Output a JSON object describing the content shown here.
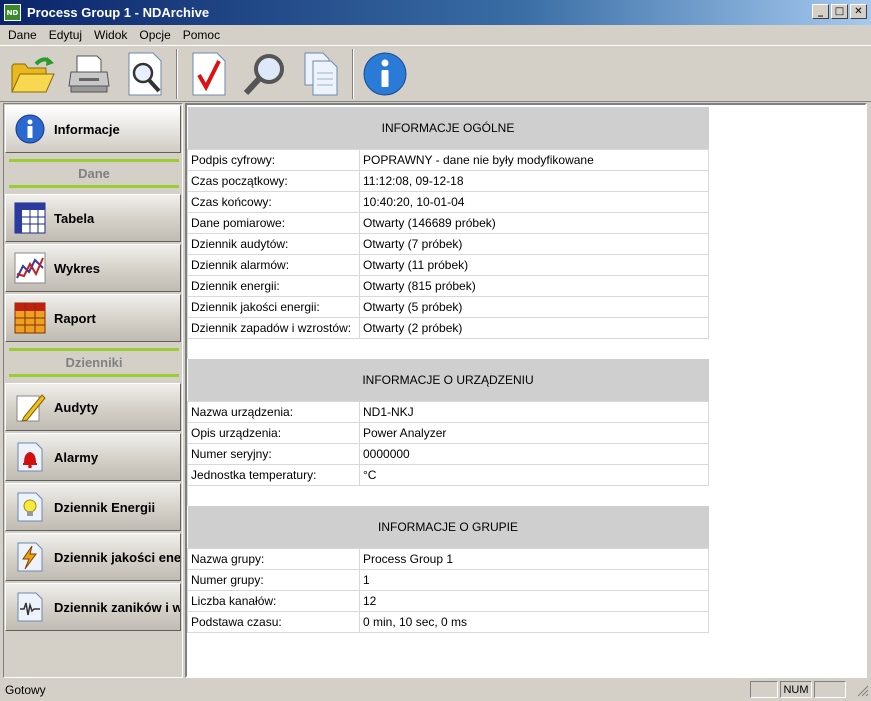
{
  "window": {
    "title": "Process Group 1 - NDArchive",
    "app_icon_text": "ND",
    "btn_minimize": "_",
    "btn_maximize": "□",
    "btn_close": "✕"
  },
  "menu": [
    "Dane",
    "Edytuj",
    "Widok",
    "Opcje",
    "Pomoc"
  ],
  "toolbar": {
    "buttons": [
      "open-folder-icon",
      "print-icon",
      "print-preview-icon",
      "verify-icon",
      "search-icon",
      "copy-icon",
      "info-icon"
    ]
  },
  "sidebar": {
    "informacje": "Informacje",
    "header_dane": "Dane",
    "tabela": "Tabela",
    "wykres": "Wykres",
    "raport": "Raport",
    "header_dzienniki": "Dzienniki",
    "audyty": "Audyty",
    "alarmy": "Alarmy",
    "dziennik_energii": "Dziennik Energii",
    "dziennik_jakosci": "Dziennik jakości energii",
    "dziennik_zanikow": "Dziennik zaników i wzrostów"
  },
  "general": {
    "header": "INFORMACJE OGÓLNE",
    "rows": [
      {
        "label": "Podpis cyfrowy:",
        "value": "POPRAWNY - dane nie były modyfikowane"
      },
      {
        "label": "Czas początkowy:",
        "value": "11:12:08, 09-12-18"
      },
      {
        "label": "Czas końcowy:",
        "value": "10:40:20, 10-01-04"
      },
      {
        "label": "Dane pomiarowe:",
        "value": "Otwarty (146689 próbek)"
      },
      {
        "label": "Dziennik audytów:",
        "value": "Otwarty (7 próbek)"
      },
      {
        "label": "Dziennik alarmów:",
        "value": "Otwarty (11 próbek)"
      },
      {
        "label": "Dziennik energii:",
        "value": "Otwarty (815 próbek)"
      },
      {
        "label": "Dziennik jakości energii:",
        "value": "Otwarty (5 próbek)"
      },
      {
        "label": "Dziennik zapadów i wzrostów:",
        "value": "Otwarty (2 próbek)"
      }
    ]
  },
  "device": {
    "header": "INFORMACJE O URZĄDZENIU",
    "rows": [
      {
        "label": "Nazwa urządzenia:",
        "value": "ND1-NKJ"
      },
      {
        "label": "Opis urządzenia:",
        "value": "Power Analyzer"
      },
      {
        "label": "Numer seryjny:",
        "value": "0000000"
      },
      {
        "label": "Jednostka temperatury:",
        "value": "°C"
      }
    ]
  },
  "group": {
    "header": "INFORMACJE O GRUPIE",
    "rows": [
      {
        "label": "Nazwa grupy:",
        "value": "Process Group 1"
      },
      {
        "label": "Numer grupy:",
        "value": "1"
      },
      {
        "label": "Liczba kanałów:",
        "value": "12"
      },
      {
        "label": "Podstawa czasu:",
        "value": "0 min, 10 sec, 0 ms"
      }
    ]
  },
  "status": {
    "text": "Gotowy",
    "num": "NUM"
  }
}
